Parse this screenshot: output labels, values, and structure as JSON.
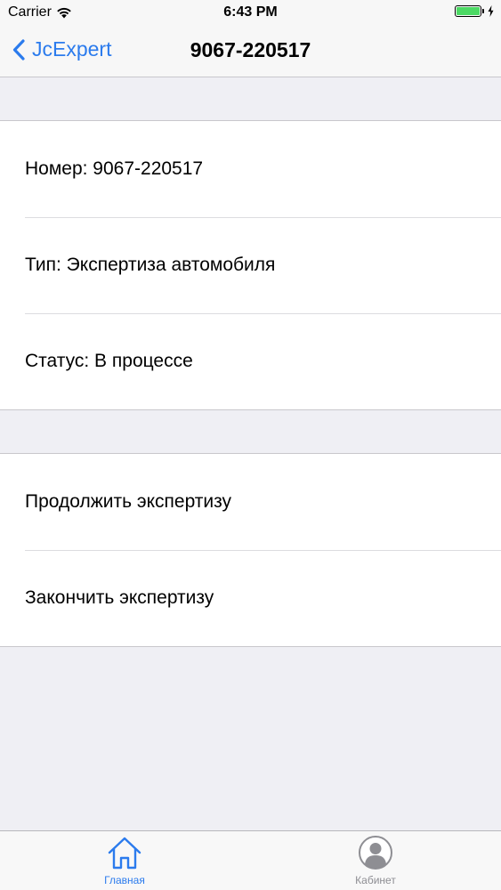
{
  "status_bar": {
    "carrier": "Carrier",
    "time": "6:43 PM",
    "battery_color": "#4cd964"
  },
  "nav": {
    "back_label": "JcExpert",
    "title": "9067-220517",
    "accent_color": "#2b7bed"
  },
  "info": {
    "number": "Номер: 9067-220517",
    "type": "Тип: Экспертиза автомобиля",
    "status": "Статус: В процессе"
  },
  "actions": {
    "continue": "Продолжить экспертизу",
    "finish": "Закончить экспертизу"
  },
  "tabs": [
    {
      "label": "Главная",
      "icon": "home-icon",
      "active": true
    },
    {
      "label": "Кабинет",
      "icon": "profile-icon",
      "active": false
    }
  ]
}
